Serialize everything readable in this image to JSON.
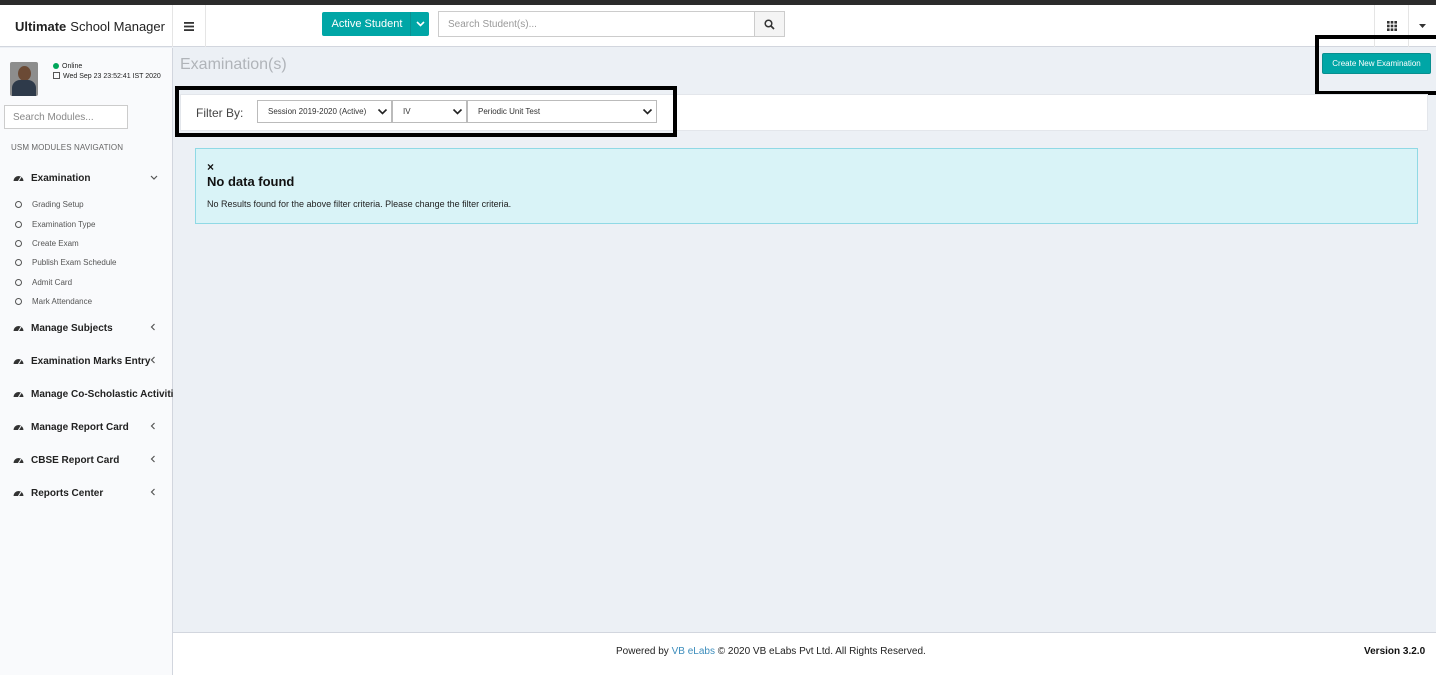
{
  "app": {
    "logo_bold": "Ultimate",
    "logo_rest": "School Manager"
  },
  "header": {
    "active_student_label": "Active Student",
    "search_placeholder": "Search Student(s)..."
  },
  "sidebar": {
    "user_status": "Online",
    "datetime": "Wed Sep 23 23:52:41 IST 2020",
    "module_search_placeholder": "Search Modules...",
    "nav_header": "USM MODULES NAVIGATION",
    "menu": [
      {
        "label": "Examination",
        "expanded": true
      },
      {
        "label": "Manage Subjects"
      },
      {
        "label": "Examination Marks Entry"
      },
      {
        "label": "Manage Co-Scholastic Activities"
      },
      {
        "label": "Manage Report Card"
      },
      {
        "label": "CBSE Report Card"
      },
      {
        "label": "Reports Center"
      }
    ],
    "exam_submenu": [
      "Grading Setup",
      "Examination Type",
      "Create Exam",
      "Publish Exam Schedule",
      "Admit Card",
      "Mark Attendance"
    ]
  },
  "content": {
    "page_title": "Examination(s)",
    "create_button": "Create New Examination",
    "filter_label": "Filter By:",
    "filters": {
      "session": "Session 2019-2020 (Active)",
      "class": "IV",
      "exam_type": "Periodic Unit Test"
    },
    "alert": {
      "close": "×",
      "title": "No data found",
      "message": "No Results found for the above filter criteria. Please change the filter criteria."
    }
  },
  "footer": {
    "powered_by": "Powered by",
    "company_link": "VB eLabs",
    "copyright": "© 2020 VB eLabs Pvt Ltd. All Rights Reserved.",
    "version": "Version 3.2.0"
  },
  "colors": {
    "accent": "#00a6a6",
    "online": "#00a65a",
    "link": "#3c8dbc",
    "alert_bg": "#d9f3f7"
  }
}
